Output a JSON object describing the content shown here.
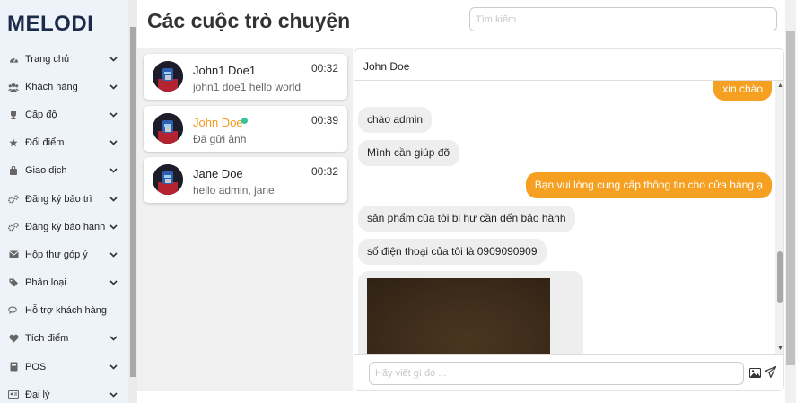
{
  "app": {
    "logo": "MELODI"
  },
  "sidebar": {
    "items": [
      {
        "label": "Trang chủ",
        "icon": "dashboard-icon",
        "has_chevron": true
      },
      {
        "label": "Khách hàng",
        "icon": "users-icon",
        "has_chevron": true
      },
      {
        "label": "Cấp độ",
        "icon": "trophy-icon",
        "has_chevron": true
      },
      {
        "label": "Đổi điểm",
        "icon": "star-icon",
        "has_chevron": true
      },
      {
        "label": "Giao dịch",
        "icon": "bag-icon",
        "has_chevron": true
      },
      {
        "label": "Đăng ký bảo trì",
        "icon": "gears-icon",
        "has_chevron": true
      },
      {
        "label": "Đăng ký bảo hành",
        "icon": "gears-icon",
        "has_chevron": true
      },
      {
        "label": "Hộp thư góp ý",
        "icon": "mail-icon",
        "has_chevron": true
      },
      {
        "label": "Phân loại",
        "icon": "tags-icon",
        "has_chevron": true
      },
      {
        "label": "Hỗ trợ khách hàng",
        "icon": "chat-icon",
        "has_chevron": false
      },
      {
        "label": "Tích điểm",
        "icon": "heart-icon",
        "has_chevron": true
      },
      {
        "label": "POS",
        "icon": "pos-icon",
        "has_chevron": true
      },
      {
        "label": "Đại lý",
        "icon": "id-card-icon",
        "has_chevron": true
      }
    ]
  },
  "header": {
    "title": "Các cuộc trò chuyện",
    "search_placeholder": "Tìm kiếm"
  },
  "conversations": [
    {
      "name": "John1 Doe1",
      "time": "00:32",
      "preview": "john1 doe1 hello world",
      "active": false,
      "online": false
    },
    {
      "name": "John Doe",
      "time": "00:39",
      "preview": "Đã gửi ảnh",
      "active": true,
      "online": true
    },
    {
      "name": "Jane Doe",
      "time": "00:32",
      "preview": "hello admin, jane",
      "active": false,
      "online": false
    }
  ],
  "chat": {
    "contact_name": "John Doe",
    "messages": [
      {
        "direction": "out",
        "text": "xin chào"
      },
      {
        "direction": "in",
        "text": "chào admin"
      },
      {
        "direction": "in",
        "text": "Mình cần giúp đỡ"
      },
      {
        "direction": "out",
        "text": "Bạn vui lòng cung cấp thông tin cho cửa hàng ạ"
      },
      {
        "direction": "in",
        "text": "sản phẩm của tôi bị hư cần đến bảo hành"
      },
      {
        "direction": "in",
        "text": "số điện thoại của tôi là 0909090909"
      },
      {
        "direction": "in",
        "type": "image"
      }
    ],
    "composer_placeholder": "Hãy viết gì đó ..."
  },
  "colors": {
    "accent": "#f5a020",
    "online": "#33c4a2",
    "active_name": "#f39a1c"
  }
}
